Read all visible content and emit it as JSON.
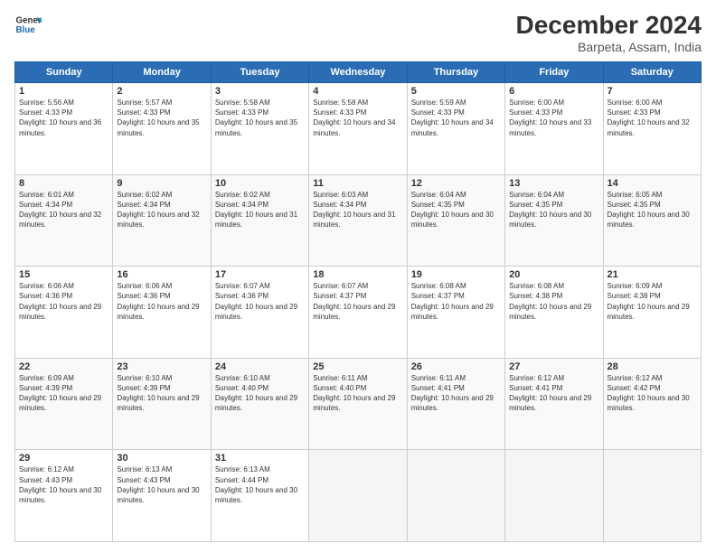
{
  "header": {
    "logo_line1": "General",
    "logo_line2": "Blue",
    "title": "December 2024",
    "subtitle": "Barpeta, Assam, India"
  },
  "weekdays": [
    "Sunday",
    "Monday",
    "Tuesday",
    "Wednesday",
    "Thursday",
    "Friday",
    "Saturday"
  ],
  "weeks": [
    [
      {
        "day": "1",
        "sunrise": "Sunrise: 5:56 AM",
        "sunset": "Sunset: 4:33 PM",
        "daylight": "Daylight: 10 hours and 36 minutes."
      },
      {
        "day": "2",
        "sunrise": "Sunrise: 5:57 AM",
        "sunset": "Sunset: 4:33 PM",
        "daylight": "Daylight: 10 hours and 35 minutes."
      },
      {
        "day": "3",
        "sunrise": "Sunrise: 5:58 AM",
        "sunset": "Sunset: 4:33 PM",
        "daylight": "Daylight: 10 hours and 35 minutes."
      },
      {
        "day": "4",
        "sunrise": "Sunrise: 5:58 AM",
        "sunset": "Sunset: 4:33 PM",
        "daylight": "Daylight: 10 hours and 34 minutes."
      },
      {
        "day": "5",
        "sunrise": "Sunrise: 5:59 AM",
        "sunset": "Sunset: 4:33 PM",
        "daylight": "Daylight: 10 hours and 34 minutes."
      },
      {
        "day": "6",
        "sunrise": "Sunrise: 6:00 AM",
        "sunset": "Sunset: 4:33 PM",
        "daylight": "Daylight: 10 hours and 33 minutes."
      },
      {
        "day": "7",
        "sunrise": "Sunrise: 6:00 AM",
        "sunset": "Sunset: 4:33 PM",
        "daylight": "Daylight: 10 hours and 32 minutes."
      }
    ],
    [
      {
        "day": "8",
        "sunrise": "Sunrise: 6:01 AM",
        "sunset": "Sunset: 4:34 PM",
        "daylight": "Daylight: 10 hours and 32 minutes."
      },
      {
        "day": "9",
        "sunrise": "Sunrise: 6:02 AM",
        "sunset": "Sunset: 4:34 PM",
        "daylight": "Daylight: 10 hours and 32 minutes."
      },
      {
        "day": "10",
        "sunrise": "Sunrise: 6:02 AM",
        "sunset": "Sunset: 4:34 PM",
        "daylight": "Daylight: 10 hours and 31 minutes."
      },
      {
        "day": "11",
        "sunrise": "Sunrise: 6:03 AM",
        "sunset": "Sunset: 4:34 PM",
        "daylight": "Daylight: 10 hours and 31 minutes."
      },
      {
        "day": "12",
        "sunrise": "Sunrise: 6:04 AM",
        "sunset": "Sunset: 4:35 PM",
        "daylight": "Daylight: 10 hours and 30 minutes."
      },
      {
        "day": "13",
        "sunrise": "Sunrise: 6:04 AM",
        "sunset": "Sunset: 4:35 PM",
        "daylight": "Daylight: 10 hours and 30 minutes."
      },
      {
        "day": "14",
        "sunrise": "Sunrise: 6:05 AM",
        "sunset": "Sunset: 4:35 PM",
        "daylight": "Daylight: 10 hours and 30 minutes."
      }
    ],
    [
      {
        "day": "15",
        "sunrise": "Sunrise: 6:06 AM",
        "sunset": "Sunset: 4:36 PM",
        "daylight": "Daylight: 10 hours and 29 minutes."
      },
      {
        "day": "16",
        "sunrise": "Sunrise: 6:06 AM",
        "sunset": "Sunset: 4:36 PM",
        "daylight": "Daylight: 10 hours and 29 minutes."
      },
      {
        "day": "17",
        "sunrise": "Sunrise: 6:07 AM",
        "sunset": "Sunset: 4:36 PM",
        "daylight": "Daylight: 10 hours and 29 minutes."
      },
      {
        "day": "18",
        "sunrise": "Sunrise: 6:07 AM",
        "sunset": "Sunset: 4:37 PM",
        "daylight": "Daylight: 10 hours and 29 minutes."
      },
      {
        "day": "19",
        "sunrise": "Sunrise: 6:08 AM",
        "sunset": "Sunset: 4:37 PM",
        "daylight": "Daylight: 10 hours and 29 minutes."
      },
      {
        "day": "20",
        "sunrise": "Sunrise: 6:08 AM",
        "sunset": "Sunset: 4:38 PM",
        "daylight": "Daylight: 10 hours and 29 minutes."
      },
      {
        "day": "21",
        "sunrise": "Sunrise: 6:09 AM",
        "sunset": "Sunset: 4:38 PM",
        "daylight": "Daylight: 10 hours and 29 minutes."
      }
    ],
    [
      {
        "day": "22",
        "sunrise": "Sunrise: 6:09 AM",
        "sunset": "Sunset: 4:39 PM",
        "daylight": "Daylight: 10 hours and 29 minutes."
      },
      {
        "day": "23",
        "sunrise": "Sunrise: 6:10 AM",
        "sunset": "Sunset: 4:39 PM",
        "daylight": "Daylight: 10 hours and 29 minutes."
      },
      {
        "day": "24",
        "sunrise": "Sunrise: 6:10 AM",
        "sunset": "Sunset: 4:40 PM",
        "daylight": "Daylight: 10 hours and 29 minutes."
      },
      {
        "day": "25",
        "sunrise": "Sunrise: 6:11 AM",
        "sunset": "Sunset: 4:40 PM",
        "daylight": "Daylight: 10 hours and 29 minutes."
      },
      {
        "day": "26",
        "sunrise": "Sunrise: 6:11 AM",
        "sunset": "Sunset: 4:41 PM",
        "daylight": "Daylight: 10 hours and 29 minutes."
      },
      {
        "day": "27",
        "sunrise": "Sunrise: 6:12 AM",
        "sunset": "Sunset: 4:41 PM",
        "daylight": "Daylight: 10 hours and 29 minutes."
      },
      {
        "day": "28",
        "sunrise": "Sunrise: 6:12 AM",
        "sunset": "Sunset: 4:42 PM",
        "daylight": "Daylight: 10 hours and 30 minutes."
      }
    ],
    [
      {
        "day": "29",
        "sunrise": "Sunrise: 6:12 AM",
        "sunset": "Sunset: 4:43 PM",
        "daylight": "Daylight: 10 hours and 30 minutes."
      },
      {
        "day": "30",
        "sunrise": "Sunrise: 6:13 AM",
        "sunset": "Sunset: 4:43 PM",
        "daylight": "Daylight: 10 hours and 30 minutes."
      },
      {
        "day": "31",
        "sunrise": "Sunrise: 6:13 AM",
        "sunset": "Sunset: 4:44 PM",
        "daylight": "Daylight: 10 hours and 30 minutes."
      },
      null,
      null,
      null,
      null
    ]
  ]
}
